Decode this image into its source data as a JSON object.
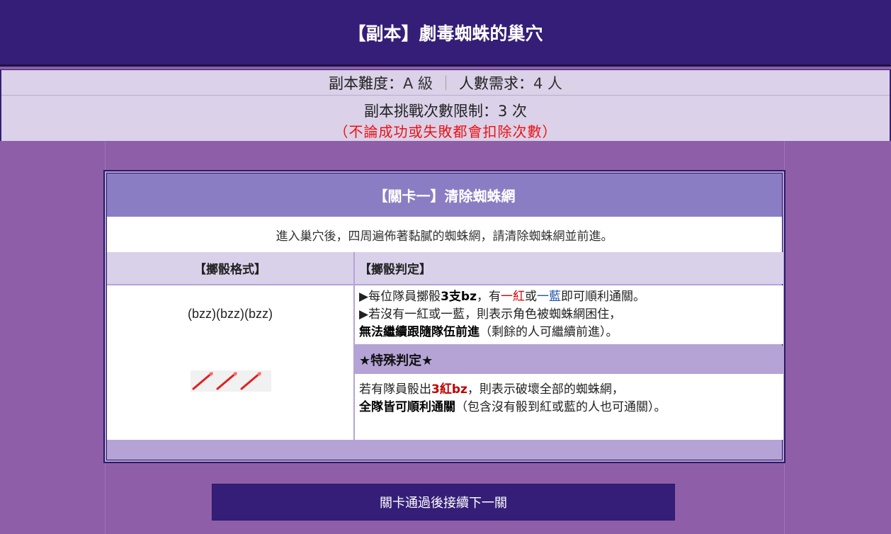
{
  "header": {
    "title": "【副本】劇毒蜘蛛的巢穴"
  },
  "info": {
    "difficulty_label": "副本難度：",
    "difficulty_value": "A 級",
    "separator": "｜",
    "players_label": "人數需求：",
    "players_value": "4 人",
    "limit_label": "副本挑戰次數限制：",
    "limit_value": "3 次",
    "warning": "（不論成功或失敗都會扣除次數）"
  },
  "stage": {
    "title": "【關卡一】清除蜘蛛網",
    "description": "進入巢穴後，四周遍佈著黏膩的蜘蛛網，請清除蜘蛛網並前進。",
    "format_header": "【擲骰格式】",
    "judge_header": "【擲骰判定】",
    "dice_format": "(bzz)(bzz)(bzz)",
    "rule1": {
      "bullet": "▶",
      "t1": "每位隊員擲骰",
      "t2": "3支bz",
      "t3": "，有",
      "t4": "一紅",
      "t5": "或",
      "t6": "一藍",
      "t7": "即可順利通關。"
    },
    "rule2": {
      "bullet": "▶",
      "t1": "若沒有一紅或一藍，則表示角色被蜘蛛網困住，"
    },
    "rule3": {
      "t1": "無法繼續跟隨隊伍前進",
      "t2": "（剩餘的人可繼續前進）。"
    },
    "special_header": "★特殊判定★",
    "special1": {
      "t1": "若有隊員骰出",
      "t2": "3紅bz",
      "t3": "，則表示破壞全部的蜘蛛網，"
    },
    "special2": {
      "t1": "全隊皆可順利通關",
      "t2": "（包含沒有骰到紅或藍的人也可通關）。"
    }
  },
  "next_button": "關卡通過後接續下一關",
  "colors": {
    "header_bg": "#351e78",
    "page_bg": "#8e5ea8",
    "accent_red": "#d40000",
    "accent_blue": "#2255aa"
  }
}
